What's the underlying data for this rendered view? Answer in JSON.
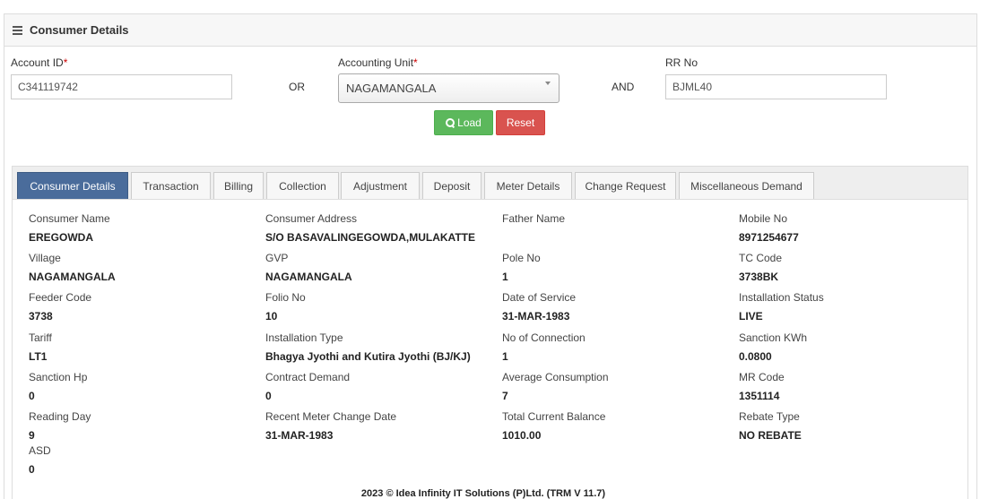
{
  "panel": {
    "title": "Consumer Details",
    "menu_icon": "hamburger-icon"
  },
  "form": {
    "account_id": {
      "label": "Account ID",
      "value": "C341119742"
    },
    "or_text": "OR",
    "accounting_unit": {
      "label": "Accounting Unit",
      "value": "NAGAMANGALA"
    },
    "and_text": "AND",
    "rr_no": {
      "label": "RR No",
      "value": "BJML40"
    },
    "required_mark": "*",
    "load_label": "Load",
    "reset_label": "Reset"
  },
  "tabs": [
    {
      "label": "Consumer Details",
      "active": true
    },
    {
      "label": "Transaction"
    },
    {
      "label": "Billing"
    },
    {
      "label": "Collection"
    },
    {
      "label": "Adjustment"
    },
    {
      "label": "Deposit"
    },
    {
      "label": "Meter Details"
    },
    {
      "label": "Change Request"
    },
    {
      "label": "Miscellaneous Demand"
    }
  ],
  "details": {
    "consumer_name": {
      "label": "Consumer Name",
      "value": "EREGOWDA"
    },
    "consumer_address": {
      "label": "Consumer Address",
      "value": "S/O BASAVALINGEGOWDA,MULAKATTE"
    },
    "father_name": {
      "label": "Father Name",
      "value": ""
    },
    "mobile_no": {
      "label": "Mobile No",
      "value": "8971254677"
    },
    "village": {
      "label": "Village",
      "value": "NAGAMANGALA"
    },
    "gvp": {
      "label": "GVP",
      "value": "NAGAMANGALA"
    },
    "pole_no": {
      "label": "Pole No",
      "value": "1"
    },
    "tc_code": {
      "label": "TC Code",
      "value": "3738BK"
    },
    "feeder_code": {
      "label": "Feeder Code",
      "value": "3738"
    },
    "folio_no": {
      "label": "Folio No",
      "value": "10"
    },
    "date_of_service": {
      "label": "Date of Service",
      "value": "31-MAR-1983"
    },
    "installation_status": {
      "label": "Installation Status",
      "value": "LIVE"
    },
    "tariff": {
      "label": "Tariff",
      "value": "LT1"
    },
    "installation_type": {
      "label": "Installation Type",
      "value": "Bhagya Jyothi and Kutira Jyothi (BJ/KJ)"
    },
    "no_of_connection": {
      "label": "No of Connection",
      "value": "1"
    },
    "sanction_kwh": {
      "label": "Sanction KWh",
      "value": "0.0800"
    },
    "sanction_hp": {
      "label": "Sanction Hp",
      "value": "0"
    },
    "contract_demand": {
      "label": "Contract Demand",
      "value": "0"
    },
    "average_consumption": {
      "label": "Average Consumption",
      "value": "7"
    },
    "mr_code": {
      "label": "MR Code",
      "value": "1351114"
    },
    "reading_day": {
      "label": "Reading Day",
      "value": "9"
    },
    "recent_meter_change_date": {
      "label": "Recent Meter Change Date",
      "value": "31-MAR-1983"
    },
    "total_current_balance": {
      "label": "Total Current Balance",
      "value": "1010.00"
    },
    "rebate_type": {
      "label": "Rebate Type",
      "value": "NO REBATE"
    },
    "asd": {
      "label": "ASD",
      "value": "0"
    }
  },
  "footer": {
    "text": "2023 © Idea Infinity IT Solutions (P)Ltd. (TRM V 11.7)"
  }
}
